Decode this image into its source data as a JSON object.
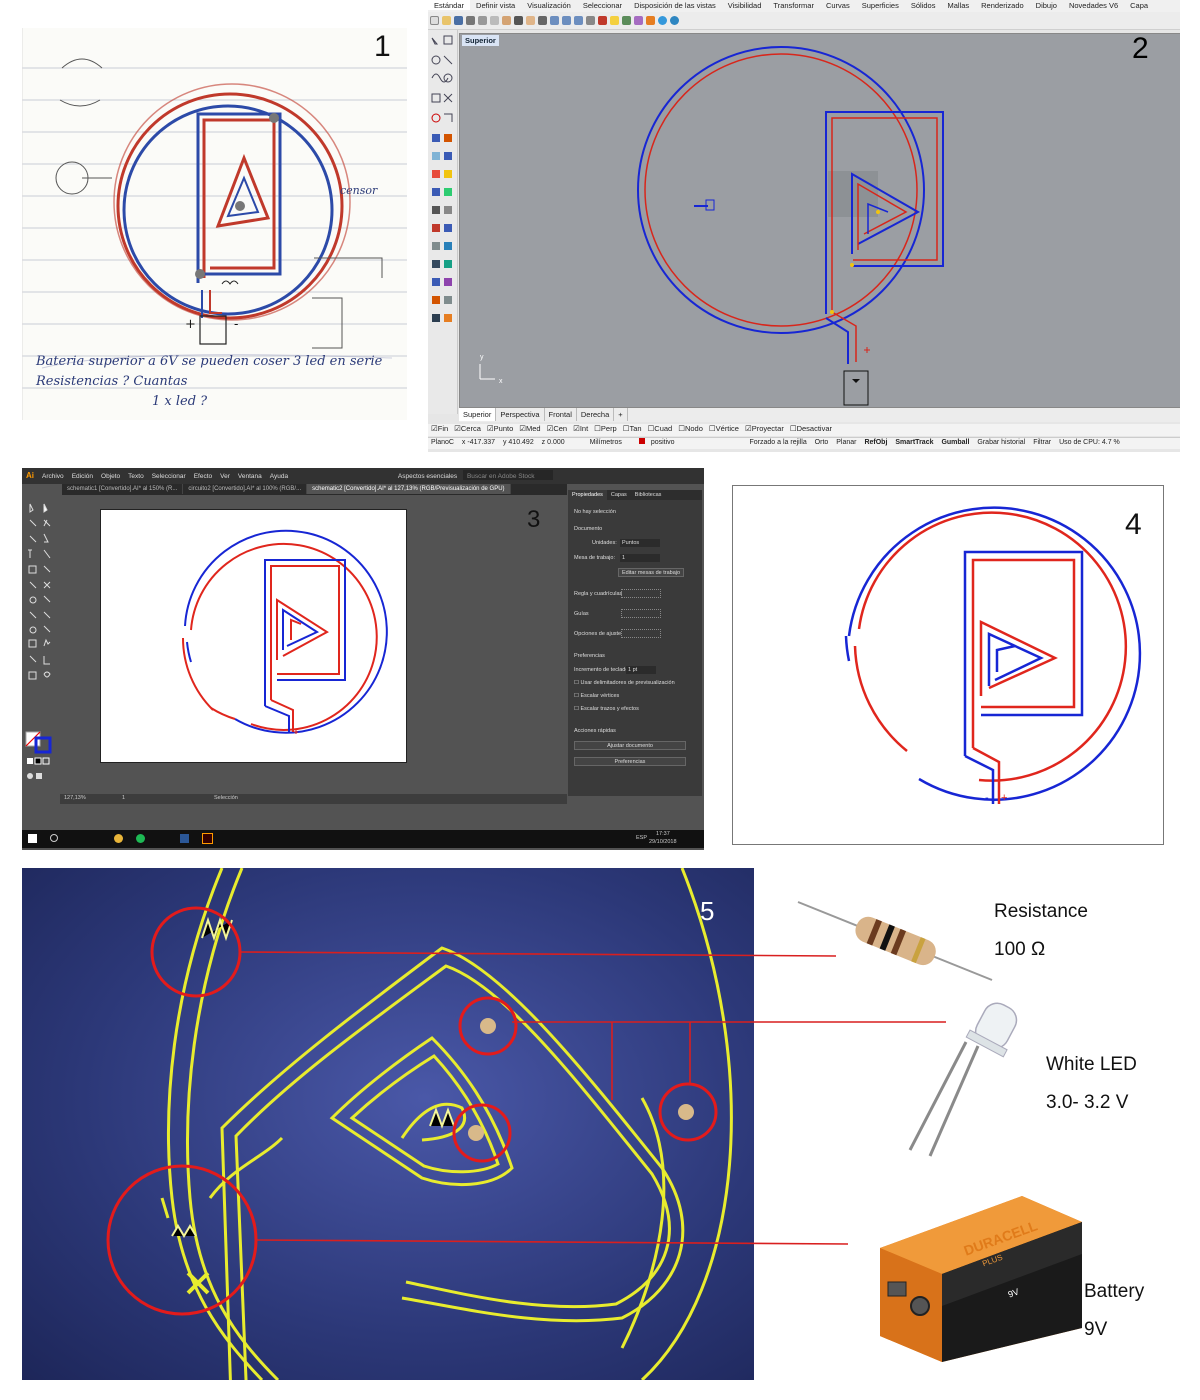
{
  "panel_numbers": [
    "1",
    "2",
    "3",
    "4",
    "5"
  ],
  "sketch": {
    "note_lines": [
      "Bateria superior a 6V se pueden coser 3 led en serie",
      "Resistencias ? Cuantas",
      "1 x led ?"
    ],
    "sensor_label": "censor",
    "plus": "+",
    "minus": "-"
  },
  "rhino": {
    "menu": [
      "Estándar",
      "Definir vista",
      "Visualización",
      "Seleccionar",
      "Disposición de las vistas",
      "Visibilidad",
      "Transformar",
      "Curvas",
      "Superficies",
      "Sólidos",
      "Mallas",
      "Renderizado",
      "Dibujo",
      "Novedades V6",
      "Capa"
    ],
    "viewport_label": "Superior",
    "view_tabs": [
      "Superior",
      "Perspectiva",
      "Frontal",
      "Derecha"
    ],
    "osnaps": [
      "Fin",
      "Cerca",
      "Punto",
      "Med",
      "Cen",
      "Int",
      "Perp",
      "Tan",
      "Cuad",
      "Nodo",
      "Vértice",
      "Proyectar",
      "Desactivar"
    ],
    "status": [
      "PlanoC",
      "x -417.337",
      "y 410.492",
      "z 0.000",
      "Milímetros",
      "positivo",
      "Forzado a la rejilla",
      "Orto",
      "Planar",
      "RefObj",
      "SmartTrack",
      "Gumball",
      "Grabar historial",
      "Filtrar",
      "Uso de CPU: 4.7 %"
    ],
    "axis_x": "x",
    "axis_y": "y"
  },
  "illustrator": {
    "menu": [
      "Archivo",
      "Edición",
      "Objeto",
      "Texto",
      "Seleccionar",
      "Efecto",
      "Ver",
      "Ventana",
      "Ayuda"
    ],
    "workspace": "Aspectos esenciales",
    "search_placeholder": "Buscar en Adobe Stock",
    "doc_tabs": [
      "schematic1 [Convertido].AI* al 150% (R...",
      "circuito2 [Convertido].AI* al 100% (RGB/...",
      "schematic2 [Convertido].AI* al 127,13% (RGB/Previsualización de GPU)"
    ],
    "panel_tabs": [
      "Propiedades",
      "Capas",
      "Bibliotecas"
    ],
    "props": {
      "no_selection": "No hay selección",
      "document": "Documento",
      "units_label": "Unidades:",
      "units_value": "Puntos",
      "artboard_label": "Mesa de trabajo:",
      "artboard_value": "1",
      "edit_artboards": "Editar mesas de trabajo",
      "rulers": "Regla y cuadrículas",
      "guides": "Guías",
      "snap": "Opciones de ajuste",
      "prefs": "Preferencias",
      "kbd_inc": "Incremento de teclado:",
      "kbd_inc_val": "1 pt",
      "check1": "Usar delimitadores de previsualización",
      "check2": "Escalar vértices",
      "check3": "Escalar trazos y efectos",
      "quick": "Acciones rápidas",
      "fit_doc": "Ajustar documento",
      "prefs_btn": "Preferencias"
    },
    "zoom": "127,13%",
    "artboard_num": "1",
    "tool": "Selección",
    "taskbar_time": "17:37",
    "taskbar_date": "29/10/2018",
    "taskbar_lang": "ESP"
  },
  "photo_labels": {
    "resistance": [
      "Resistance",
      "100 Ω"
    ],
    "led": [
      "White LED",
      "3.0- 3.2 V"
    ],
    "battery": [
      "Battery",
      "9V"
    ],
    "battery_brand": "DURACELL",
    "battery_sub": "PLUS",
    "battery_volt": "9V",
    "minus": "-",
    "plus": "+"
  },
  "colors": {
    "red": "#e8211d",
    "blue": "#1726d4",
    "thread": "#e8ec2e",
    "fabric": "#2e3a7c",
    "circle_red": "#d91f1f"
  }
}
